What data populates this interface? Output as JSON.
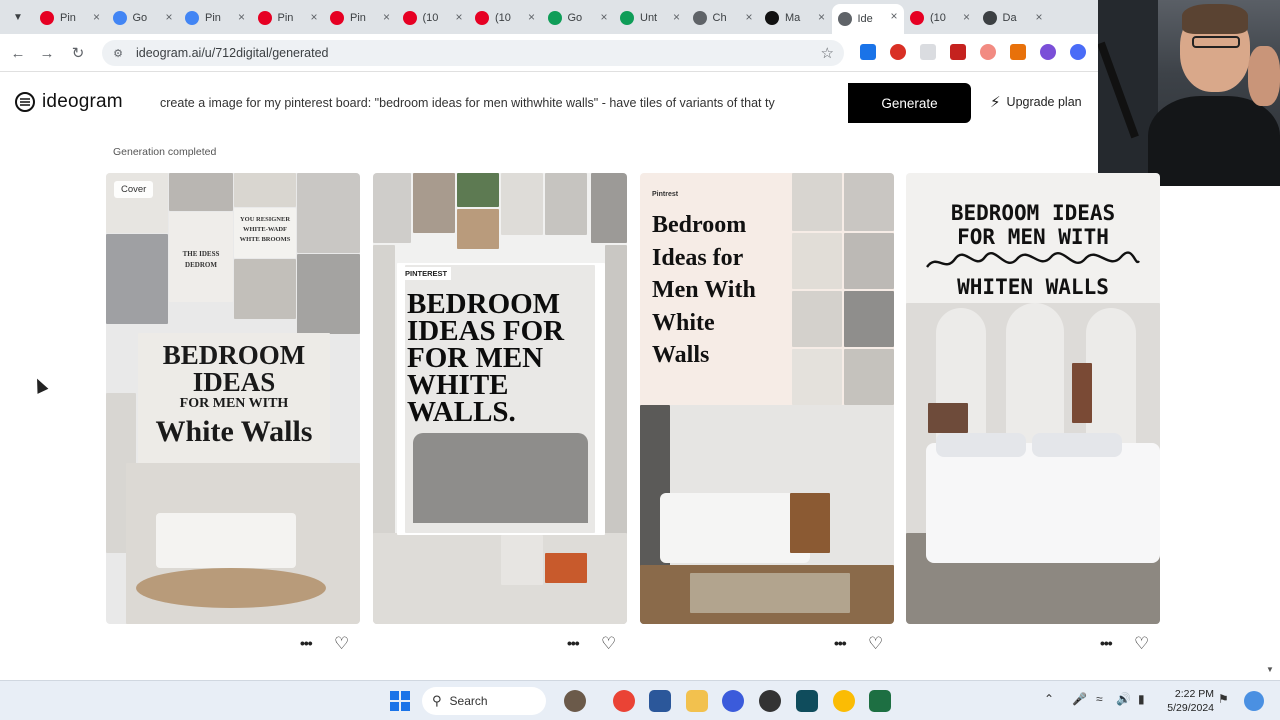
{
  "browser": {
    "tabs": [
      {
        "label": "Pin",
        "favicon": "pinterest-icon",
        "color": "#e60023"
      },
      {
        "label": "Go",
        "favicon": "docs-icon",
        "color": "#4285f4"
      },
      {
        "label": "Pin",
        "favicon": "docs-icon",
        "color": "#4285f4"
      },
      {
        "label": "Pin",
        "favicon": "pinterest-icon",
        "color": "#e60023"
      },
      {
        "label": "Pin",
        "favicon": "pinterest-icon",
        "color": "#e60023"
      },
      {
        "label": "(10",
        "favicon": "pinterest-icon",
        "color": "#e60023"
      },
      {
        "label": "(10",
        "favicon": "pinterest-icon",
        "color": "#e60023"
      },
      {
        "label": "Go",
        "favicon": "sheets-icon",
        "color": "#0f9d58"
      },
      {
        "label": "Unt",
        "favicon": "sheets-icon",
        "color": "#0f9d58"
      },
      {
        "label": "Ch",
        "favicon": "chatgpt-icon",
        "color": "#5f6368"
      },
      {
        "label": "Ma",
        "favicon": "medium-icon",
        "color": "#111111"
      },
      {
        "label": "Ide",
        "favicon": "ideogram-icon",
        "color": "#5f6368"
      },
      {
        "label": "(10",
        "favicon": "pinterest-icon",
        "color": "#e60023"
      },
      {
        "label": "Da",
        "favicon": "dashboard-icon",
        "color": "#3c4043"
      }
    ],
    "url": "ideogram.ai/u/712digital/generated"
  },
  "app": {
    "logo_text": "ideogram",
    "prompt_text": "create a image for my pinterest board: \"bedroom ideas for men  withwhite walls\" - have tiles of variants of that ty",
    "generate_label": "Generate",
    "upgrade_label": "Upgrade plan",
    "status_text": "Generation completed"
  },
  "cards": [
    {
      "badge": "Cover",
      "title_lines": [
        "BEDROOM",
        "IDEAS",
        "FOR MEN WITH",
        "White Walls"
      ],
      "small_texts": [
        "YOU RESIGNER",
        "WHITE-WADF",
        "WHTE BROOMS",
        "THE IDESS",
        "DEDROM",
        "WHITE"
      ]
    },
    {
      "badge": "PINTEREST",
      "title_lines": [
        "BEDROOM",
        "IDEAS FOR",
        "FOR MEN",
        "WHITE",
        "WALLS."
      ]
    },
    {
      "badge": "Pintrest",
      "title_lines": [
        "Bedroom",
        "Ideas for",
        "Men With",
        "White",
        "Walls"
      ]
    },
    {
      "badge": "",
      "title_lines": [
        "BEDROOM IDEAS",
        "FOR MEN WITH",
        "WHITEN WALLS"
      ]
    }
  ],
  "taskbar": {
    "search_label": "Search",
    "time": "2:22 PM",
    "date": "5/29/2024"
  }
}
